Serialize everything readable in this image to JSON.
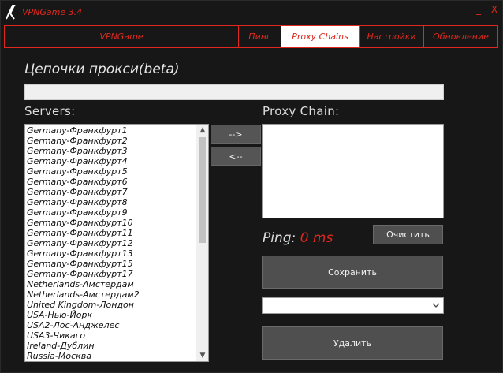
{
  "window": {
    "title": "VPNGame 3.4",
    "minimize_glyph": "_",
    "close_glyph": "X"
  },
  "tabs": [
    {
      "label": "VPNGame",
      "active": false
    },
    {
      "label": "Пинг",
      "active": false
    },
    {
      "label": "Proxy Chains",
      "active": true
    },
    {
      "label": "Настройки",
      "active": false
    },
    {
      "label": "Обновление",
      "active": false
    }
  ],
  "main": {
    "heading": "Цепочки прокси(beta)",
    "servers_label": "Servers:",
    "chain_label": "Proxy Chain:",
    "servers": [
      "Germany-Франкфурт1",
      "Germany-Франкфурт2",
      "Germany-Франкфурт3",
      "Germany-Франкфурт4",
      "Germany-Франкфурт5",
      "Germany-Франкфурт6",
      "Germany-Франкфурт7",
      "Germany-Франкфурт8",
      "Germany-Франкфурт9",
      "Germany-Франкфурт10",
      "Germany-Франкфурт11",
      "Germany-Франкфурт12",
      "Germany-Франкфурт13",
      "Germany-Франкфурт15",
      "Germany-Франкфурт17",
      "Netherlands-Амстердам",
      "Netherlands-Амстердам2",
      "United Kingdom-Лондон",
      "USA-Нью-Йорк",
      "USA2-Лос-Анджелес",
      "USA3-Чикаго",
      "Ireland-Дублин",
      "Russia-Москва"
    ],
    "add_button": "-->",
    "remove_button": "<--",
    "ping_label": "Ping:",
    "ping_value": "0 ms",
    "clear_button": "Очистить",
    "save_button": "Сохранить",
    "combo_value": "",
    "delete_button": "Удалить"
  },
  "colors": {
    "accent": "#e0281e",
    "background": "#171717",
    "button": "#4f4f4f"
  },
  "icons": {
    "logo": "vpngame-logo-icon",
    "scroll_up": "chevron-up-icon",
    "scroll_down": "chevron-down-icon",
    "dropdown": "chevron-down-icon"
  }
}
